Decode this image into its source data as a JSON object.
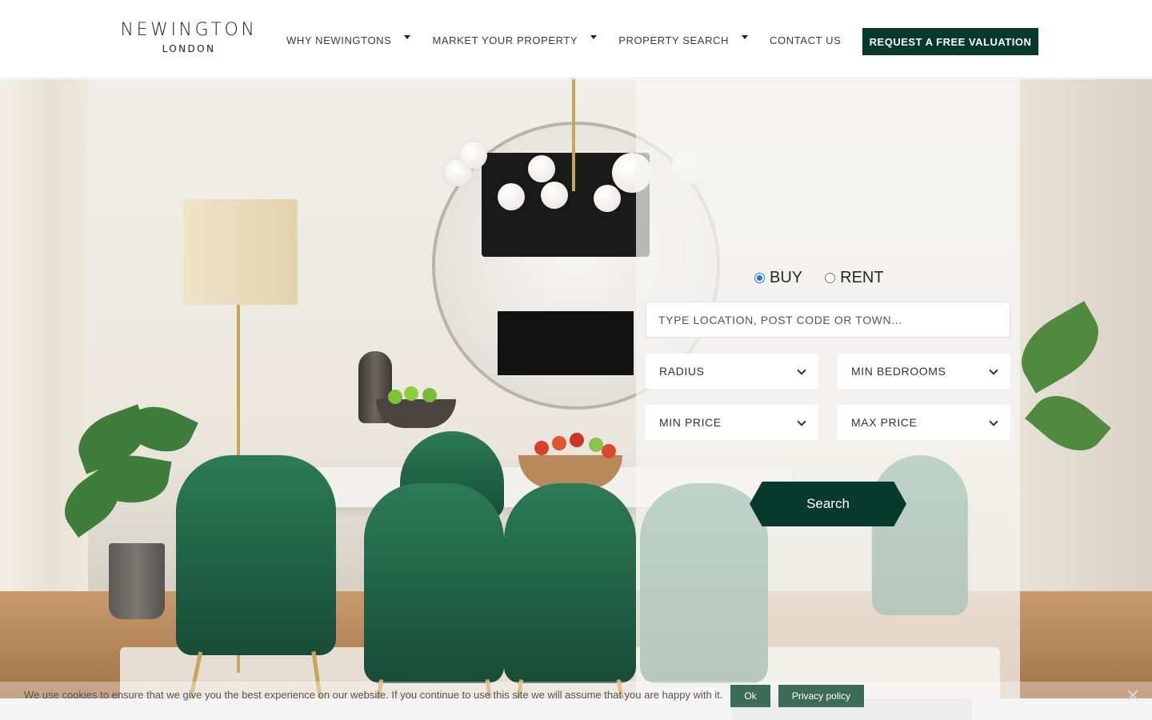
{
  "brand": {
    "name": "NEWINGTON",
    "sub": "LONDON"
  },
  "nav": {
    "items": [
      {
        "label": "WHY NEWINGTONS",
        "has_dropdown": true
      },
      {
        "label": "MARKET YOUR PROPERTY",
        "has_dropdown": true
      },
      {
        "label": "PROPERTY SEARCH",
        "has_dropdown": true
      },
      {
        "label": "CONTACT US",
        "has_dropdown": false
      }
    ],
    "cta_label": "REQUEST A FREE VALUATION"
  },
  "search": {
    "mode_options": [
      {
        "label": "BUY",
        "checked": true
      },
      {
        "label": "RENT",
        "checked": false
      }
    ],
    "location_placeholder": "TYPE LOCATION, POST CODE OR TOWN...",
    "selects": {
      "radius": "RADIUS",
      "min_bedrooms": "MIN BEDROOMS",
      "min_price": "MIN PRICE",
      "max_price": "MAX PRICE"
    },
    "submit_label": "Search"
  },
  "cookie": {
    "text": "We use cookies to ensure that we give you the best experience on our website. If you continue to use this site we will assume that you are happy with it.",
    "ok_label": "Ok",
    "privacy_label": "Privacy policy"
  },
  "colors": {
    "brand_green": "#073a2c",
    "cookie_button": "#3d6b5a"
  }
}
